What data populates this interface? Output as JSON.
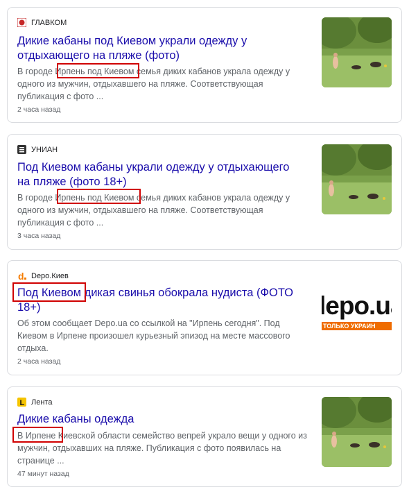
{
  "articles": [
    {
      "source": "ГЛАВКОМ",
      "source_icon": "glavkom-logo-icon",
      "title": "Дикие кабаны под Киевом украли одежду у отдыхающего на пляже (фото)",
      "snippet": "В городе Ирпень под Киевом семья диких кабанов украла одежду у одного из мужчин, отдыхавшего на пляже. Соответствующая публикация с фото ...",
      "highlight": "Ирпень под Киевом",
      "time": "2 часа назад"
    },
    {
      "source": "УНИАН",
      "source_icon": "unian-logo-icon",
      "title": "Под Киевом кабаны украли одежду у отдыхающего на пляже (фото 18+)",
      "snippet": "В городе Ирпень под Киевом семья диких кабанов украла одежду у одного из мужчин, отдыхавшего на пляже. Соответствующая публикация с фото ...",
      "highlight": "Ирпень под Киевом",
      "time": "3 часа назад"
    },
    {
      "source": "Depo.Киев",
      "source_icon": "depo-logo-icon",
      "title": "Под Киевом дикая свинья обокрала нудиста (ФОТО 18+)",
      "snippet": "Об этом сообщает Depo.ua со ссылкой на \"Ирпень сегодня\". Под Киевом в Ирпене произошел курьезный эпизод на месте массового отдыха.",
      "highlight": "Под Киевом",
      "time": "2 часа назад",
      "thumb_logo": "lepo.ua",
      "thumb_tagline": "ТОЛЬКО УКРАИН"
    },
    {
      "source": "Лента",
      "source_icon": "lenta-logo-icon",
      "title": "Дикие кабаны одежда",
      "snippet": "В Ирпене Киевской области семейство вепрей украло вещи у одного из мужчин, отдыхавших на пляже. Публикация с фото появилась на странице ...",
      "highlight": "В Ирпене",
      "time": "47 минут назад"
    }
  ],
  "colors": {
    "highlight_box": "#d00000",
    "title": "#1a0dab",
    "snippet": "#5f6368",
    "border": "#dadce0"
  }
}
